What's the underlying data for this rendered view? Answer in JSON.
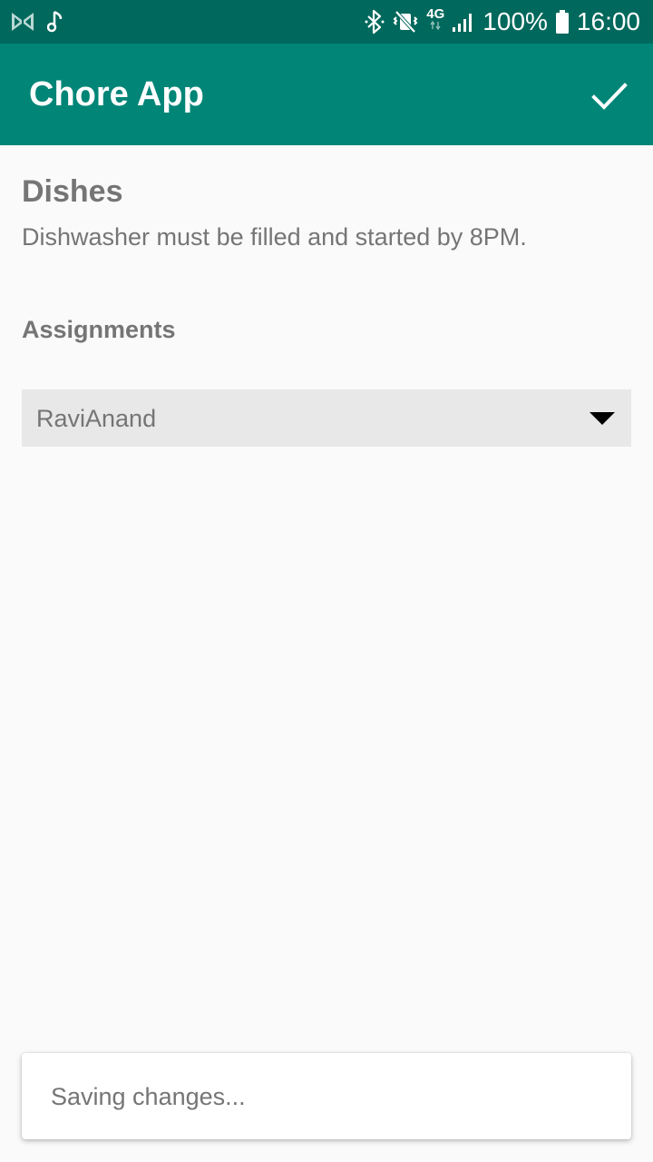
{
  "status_bar": {
    "network_type": "4G",
    "battery_percent": "100%",
    "time": "16:00",
    "icons": [
      "app-notification-icon",
      "music-note-icon",
      "bluetooth-icon",
      "vibrate-mute-icon",
      "signal-icon",
      "battery-icon"
    ]
  },
  "app_bar": {
    "title": "Chore App",
    "confirm_icon": "check-icon"
  },
  "chore": {
    "title": "Dishes",
    "description": "Dishwasher must be filled and started by 8PM."
  },
  "assignments": {
    "label": "Assignments",
    "selected": "RaviAnand",
    "dropdown_icon": "arrow-drop-down-icon"
  },
  "snackbar": {
    "message": "Saving changes..."
  },
  "colors": {
    "status_bar": "#00685c",
    "app_bar": "#008577",
    "text_secondary": "#757575",
    "spinner_bg": "#e8e8e8",
    "background": "#fafafa"
  }
}
